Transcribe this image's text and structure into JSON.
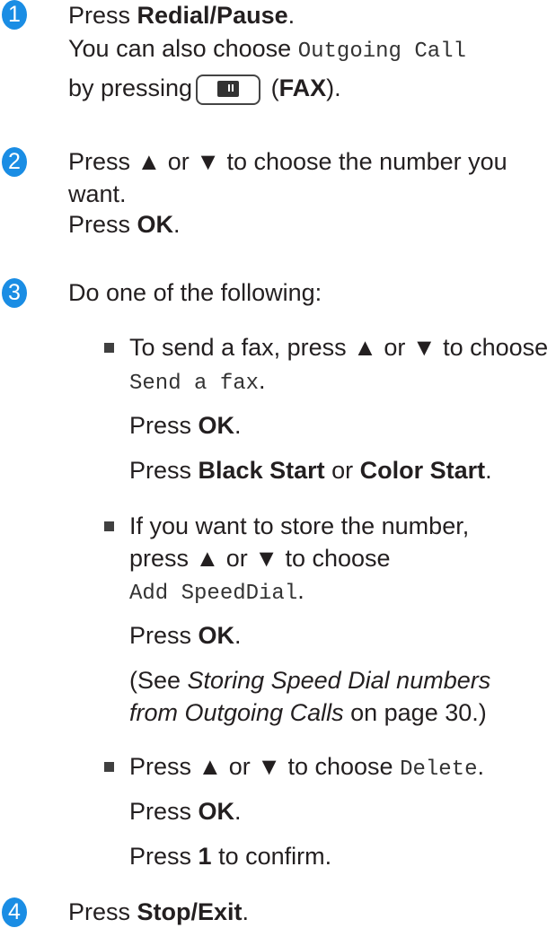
{
  "step1": {
    "num": "1",
    "l1_pre": "Press ",
    "l1_bold": "Redial/Pause",
    "l1_post": ".",
    "l2_pre": "You can also choose ",
    "l2_mono": "Outgoing Call",
    "l3_pre": "by pressing",
    "l3_mid": " (",
    "l3_bold": "FAX",
    "l3_post": ")."
  },
  "step2": {
    "num": "2",
    "l1": "Press ▲ or ▼ to choose the number you",
    "l2": "want.",
    "l3_pre": "Press ",
    "l3_bold": "OK",
    "l3_post": "."
  },
  "step3": {
    "num": "3",
    "intro": "Do one of the following:",
    "a": {
      "l1": "To send a fax, press ▲ or ▼ to choose",
      "l2_mono": "Send a fax",
      "l2_post": ".",
      "l3_pre": "Press ",
      "l3_bold": "OK",
      "l3_post": ".",
      "l4_pre": "Press ",
      "l4_b1": "Black Start",
      "l4_mid": " or ",
      "l4_b2": "Color Start",
      "l4_post": "."
    },
    "b": {
      "l1": "If you want to store the number,",
      "l2": "press ▲ or ▼ to choose",
      "l3_mono": "Add SpeedDial",
      "l3_post": ".",
      "l4_pre": "Press ",
      "l4_bold": "OK",
      "l4_post": ".",
      "l5_pre": "(See ",
      "l5_it": "Storing Speed Dial numbers",
      "l6_it": "from Outgoing Calls",
      "l6_post": " on page 30.)"
    },
    "c": {
      "l1_pre": "Press ▲ or ▼ to choose ",
      "l1_mono": "Delete",
      "l1_post": ".",
      "l2_pre": "Press ",
      "l2_bold": "OK",
      "l2_post": ".",
      "l3_pre": "Press ",
      "l3_bold": "1",
      "l3_post": " to confirm."
    }
  },
  "step4": {
    "num": "4",
    "l1_pre": "Press ",
    "l1_bold": "Stop/Exit",
    "l1_post": "."
  }
}
